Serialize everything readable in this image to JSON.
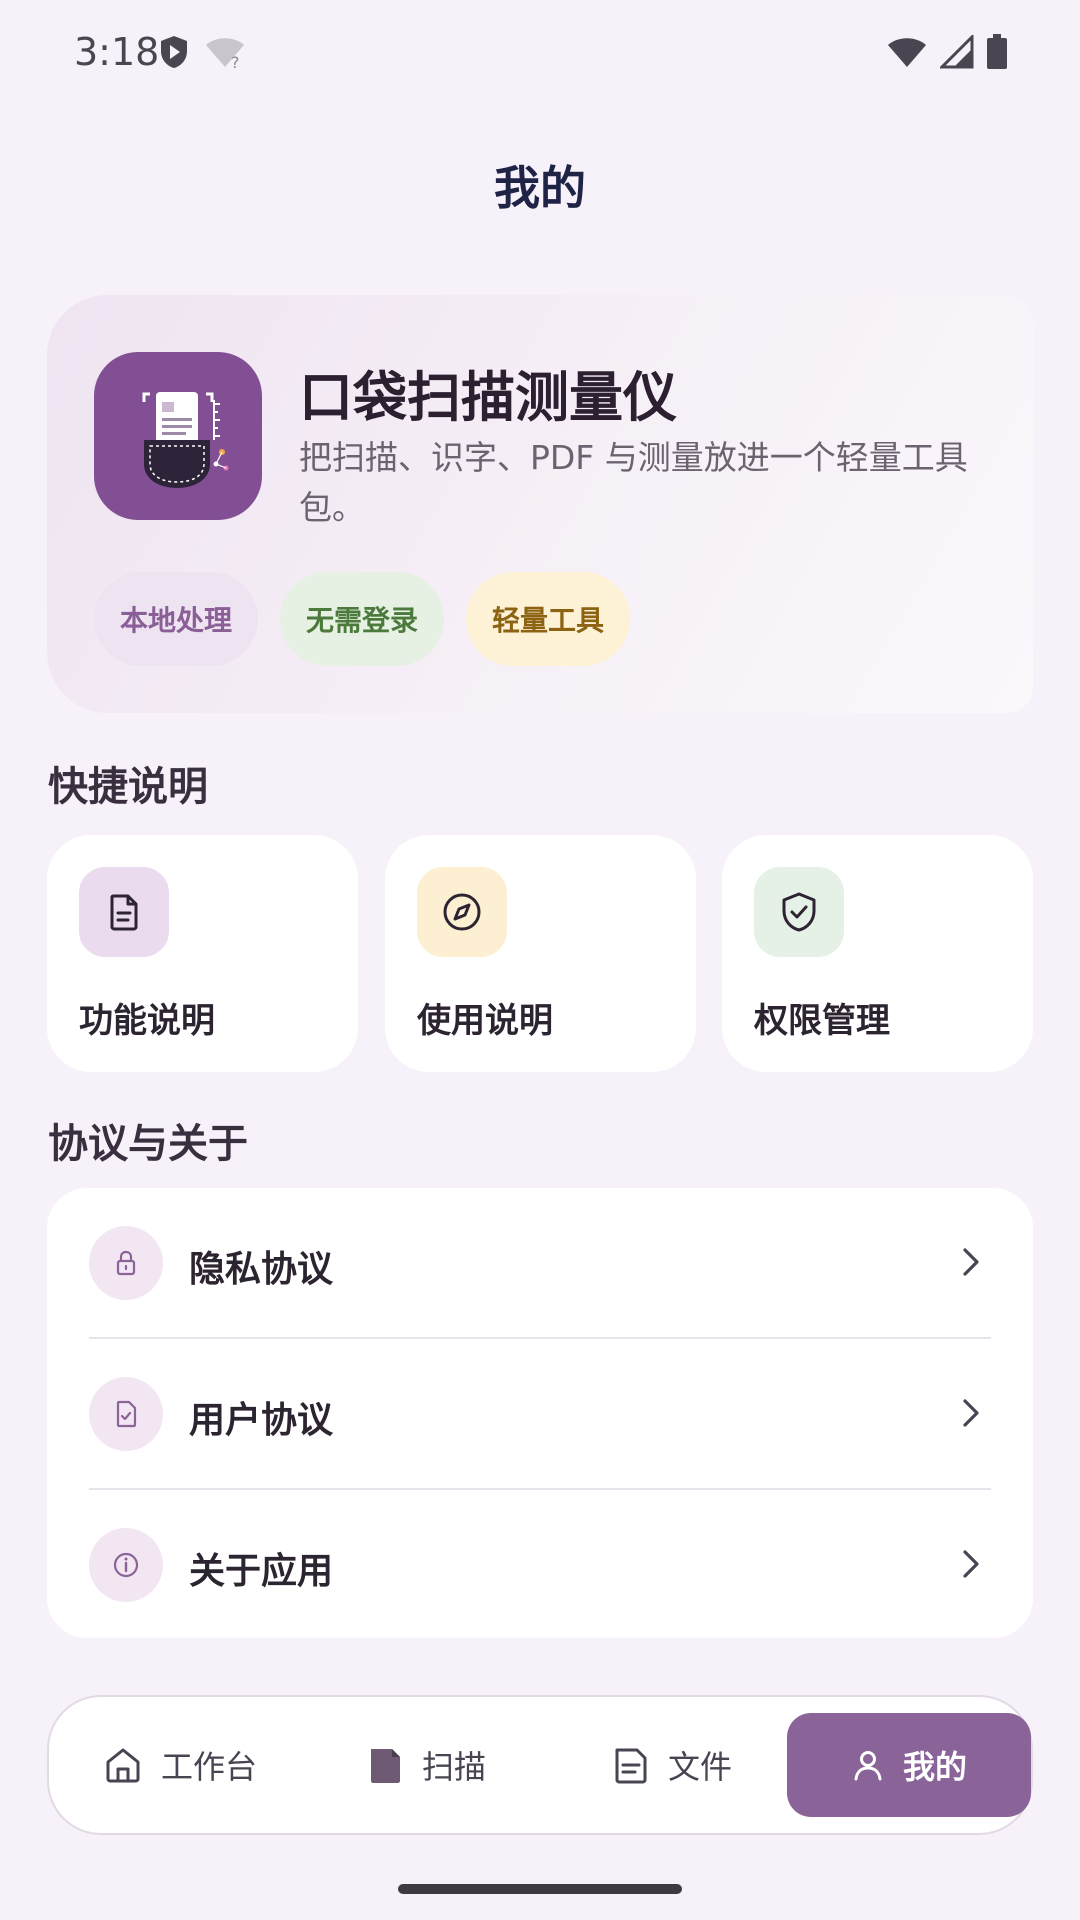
{
  "status_bar": {
    "time": "3:18",
    "icons": [
      "vpn-shield-icon",
      "wifi-unknown-icon",
      "wifi-alert-icon",
      "cell-signal-icon",
      "battery-icon"
    ]
  },
  "header": {
    "title": "我的"
  },
  "hero": {
    "app_name": "口袋扫描测量仪",
    "description": "把扫描、识字、PDF 与测量放进一个轻量工具包。",
    "tags": [
      {
        "label": "本地处理",
        "color": "#8A5E97"
      },
      {
        "label": "无需登录",
        "color": "#4C7A3C"
      },
      {
        "label": "轻量工具",
        "color": "#8C6312"
      }
    ]
  },
  "quick_section": {
    "title": "快捷说明",
    "cards": [
      {
        "label": "功能说明",
        "icon": "document-icon",
        "bg": "#EADCEE"
      },
      {
        "label": "使用说明",
        "icon": "compass-icon",
        "bg": "#FDEFD2"
      },
      {
        "label": "权限管理",
        "icon": "shield-check-icon",
        "bg": "#E5F1E6"
      }
    ]
  },
  "about_section": {
    "title": "协议与关于",
    "items": [
      {
        "label": "隐私协议",
        "icon": "lock-icon"
      },
      {
        "label": "用户协议",
        "icon": "document-check-icon"
      },
      {
        "label": "关于应用",
        "icon": "info-icon"
      }
    ]
  },
  "bottom_nav": {
    "items": [
      {
        "label": "工作台",
        "icon": "home-icon",
        "active": false
      },
      {
        "label": "扫描",
        "icon": "scan-icon",
        "active": false
      },
      {
        "label": "文件",
        "icon": "file-icon",
        "active": false
      },
      {
        "label": "我的",
        "icon": "person-icon",
        "active": true
      }
    ]
  },
  "colors": {
    "background": "#F7F2F9",
    "accent": "#8A6398",
    "logo": "#834F94"
  }
}
